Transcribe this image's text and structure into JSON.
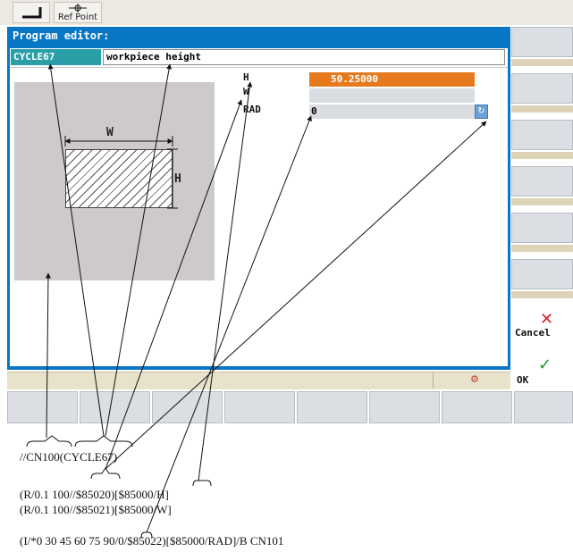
{
  "toolbar": {
    "ref_point_label": "Ref Point"
  },
  "dialog": {
    "title": "Program editor:",
    "cycle_name": "CYCLE67",
    "field_description": "workpiece height",
    "diagram": {
      "w_label": "W",
      "h_label": "H"
    },
    "params": [
      {
        "label": "H",
        "value": "50.25000"
      },
      {
        "label": "W",
        "value": ""
      },
      {
        "label": "RAD",
        "value": "0"
      }
    ]
  },
  "softkeys": {
    "cancel_label": "Cancel",
    "ok_label": "OK"
  },
  "code": {
    "line1": "//CN100(CYCLE67)",
    "line2": "(R/0.1 100//$85020)[$85000/H]",
    "line3": "(R/0.1 100//$85021)[$85000/W]",
    "line4": "(I/*0 30 45 60 75 90/0/$85022)[$85000/RAD]/B CN101"
  },
  "colors": {
    "dialog_border": "#0a76c6",
    "cycle_label_bg": "#2a9fa8",
    "active_field": "#e57a1f",
    "cancel_icon": "#e02020",
    "ok_icon": "#1a9a2a"
  }
}
